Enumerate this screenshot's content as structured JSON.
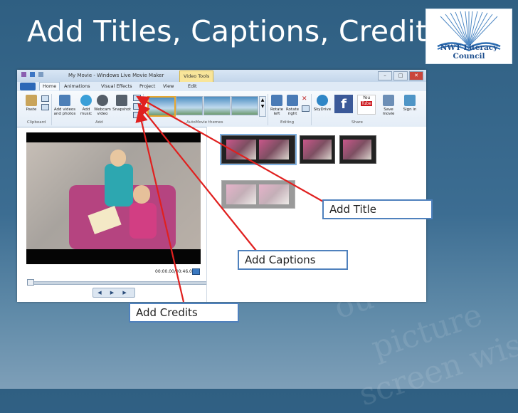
{
  "slide": {
    "title": "Add Titles, Captions, Credits",
    "logo": {
      "text": "NWT Literacy Council",
      "icon": "open-book-icon"
    }
  },
  "app": {
    "window_title": "My Movie - Windows Live Movie Maker",
    "context_tab": "Video Tools",
    "tabs": [
      "Home",
      "Animations",
      "Visual Effects",
      "Project",
      "View",
      "Edit"
    ],
    "selected_tab": "Home",
    "ribbon": {
      "paste": "Paste",
      "add_videos": "Add videos and photos",
      "add_music": "Add music",
      "webcam": "Webcam video",
      "snapshot": "Snapshot",
      "rotate_left": "Rotate left",
      "rotate_right": "Rotate right",
      "skydrive": "SkyDrive",
      "save_movie": "Save movie",
      "sign_in": "Sign in",
      "groups": {
        "clipboard": "Clipboard",
        "add": "Add",
        "themes": "AutoMovie themes",
        "editing": "Editing",
        "share": "Share"
      }
    },
    "time_display": "00:00.00/00:46.00",
    "play_controls": "◀ ▶ ▶"
  },
  "callouts": {
    "title": "Add Title",
    "captions": "Add Captions",
    "credits": "Add Credits"
  },
  "colors": {
    "background": "#3c6d92",
    "callout_border": "#4f81bd",
    "arrow": "#e0201f"
  }
}
